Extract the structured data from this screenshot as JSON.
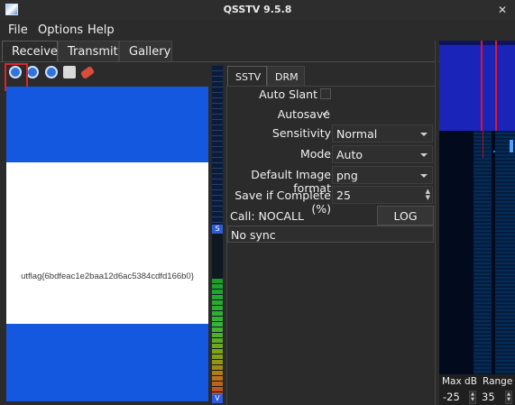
{
  "window": {
    "title": "QSSTV 9.5.8",
    "close_glyph": "✕"
  },
  "menu": {
    "file": "File",
    "options": "Options",
    "help": "Help"
  },
  "tabs": {
    "receive": "Receive",
    "transmit": "Transmit",
    "gallery": "Gallery"
  },
  "toolbar": {
    "icons": [
      "start-icon",
      "stop-icon",
      "erase-icon",
      "save-icon",
      "clear-icon"
    ],
    "colors": {
      "start": "#2f74d8",
      "stop": "#2f74d8",
      "erase": "#2f74d8",
      "save": "#d9d9d9",
      "clear": "#d94b3b",
      "highlight": "#d9262d"
    }
  },
  "image": {
    "text": "utflag{6bdfeac1e2baa12d6ac5384cdfd166b0}",
    "colors": {
      "band": "#1558e0",
      "center": "#ffffff"
    }
  },
  "meter": {
    "s_label": "S",
    "v_label": "V"
  },
  "subtabs": {
    "sstv": "SSTV",
    "drm": "DRM"
  },
  "settings": {
    "auto_slant_label": "Auto Slant",
    "autosave_label": "Autosave",
    "autosave_check": "✓",
    "sensitivity_label": "Sensitivity",
    "sensitivity_value": "Normal",
    "mode_label": "Mode",
    "mode_value": "Auto",
    "image_format_label": "Default Image format",
    "image_format_value": "png",
    "save_if_complete_label": "Save if Complete (%)",
    "save_if_complete_value": "25",
    "call_label": "Call: NOCALL",
    "log_qso_button": "LOG QSO",
    "status": "No sync"
  },
  "waterfall": {
    "max_db_label": "Max dB",
    "range_label": "Range",
    "max_db_value": "-25",
    "range_value": "35",
    "colors": {
      "top": "#1a24b8",
      "marker": "#e0152e",
      "bottom": "#020a1e"
    }
  }
}
